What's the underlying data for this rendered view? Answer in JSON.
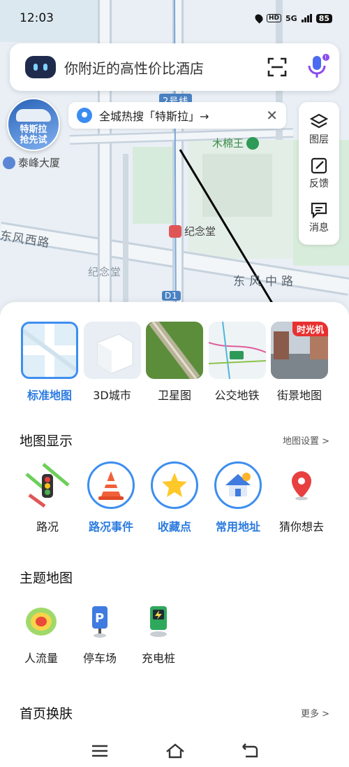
{
  "status": {
    "time": "12:03",
    "hd": "HD",
    "network": "5G",
    "battery": "85"
  },
  "search": {
    "placeholder": "你附近的高性价比酒店"
  },
  "promo": {
    "text": "全城热搜「特斯拉」→"
  },
  "tesla": {
    "line1": "特斯拉",
    "line2": "抢先试"
  },
  "map": {
    "labels": [
      "泰峰大厦",
      "木棉王",
      "纪念堂",
      "东风西路",
      "东风中路",
      "纪念堂",
      "2号线",
      "D1"
    ]
  },
  "tools": [
    {
      "label": "图层",
      "icon": "layers-icon"
    },
    {
      "label": "反馈",
      "icon": "feedback-icon"
    },
    {
      "label": "消息",
      "icon": "message-icon"
    }
  ],
  "map_types": [
    {
      "label": "标准地图",
      "active": true
    },
    {
      "label": "3D城市",
      "active": false
    },
    {
      "label": "卫星图",
      "active": false
    },
    {
      "label": "公交地铁",
      "active": false
    },
    {
      "label": "街景地图",
      "active": false,
      "badge": "时光机"
    }
  ],
  "display": {
    "title": "地图显示",
    "settings_link": "地图设置 >",
    "items": [
      {
        "label": "路况",
        "active": false
      },
      {
        "label": "路况事件",
        "active": true
      },
      {
        "label": "收藏点",
        "active": true
      },
      {
        "label": "常用地址",
        "active": true
      },
      {
        "label": "猜你想去",
        "active": false
      }
    ]
  },
  "themes": {
    "title": "主题地图",
    "items": [
      {
        "label": "人流量"
      },
      {
        "label": "停车场"
      },
      {
        "label": "充电桩"
      }
    ]
  },
  "skins": {
    "title": "首页换肤",
    "more": "更多 >"
  },
  "colors": {
    "accent": "#2b7be0",
    "road": "#c7d3de",
    "panel": "#ffffff"
  }
}
